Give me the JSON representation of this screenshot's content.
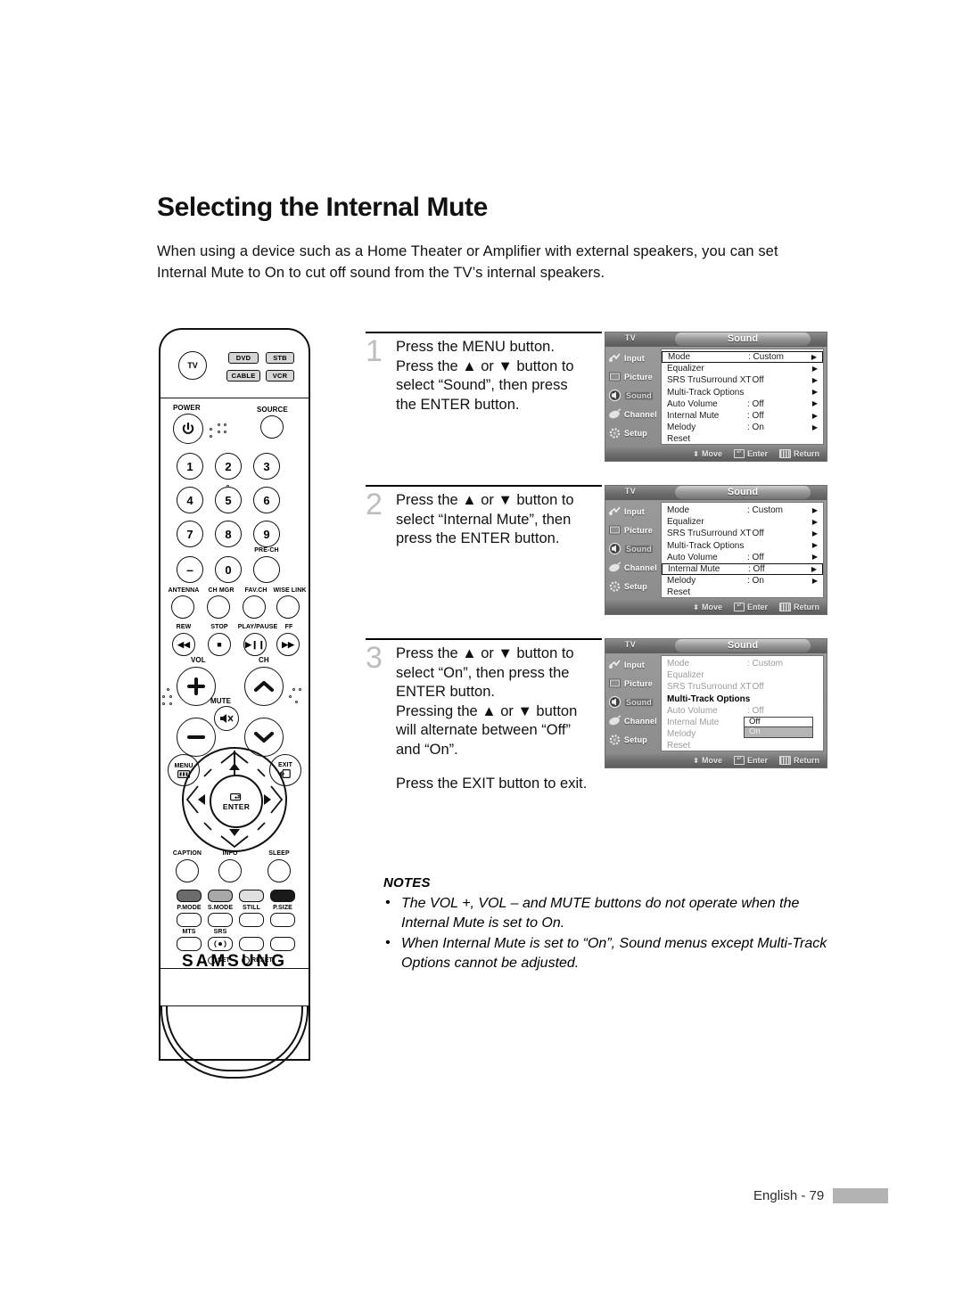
{
  "page": {
    "title": "Selecting the Internal Mute",
    "intro": "When using a device such as a Home Theater or Amplifier with external speakers, you can set Internal Mute to On to cut off sound from the TV’s internal speakers.",
    "footer_text": "English - 79"
  },
  "steps": [
    {
      "number": "1",
      "lines": [
        "Press the MENU button.",
        "Press the ▲ or ▼ button to",
        "select “Sound”, then press",
        "the ENTER button."
      ]
    },
    {
      "number": "2",
      "lines": [
        "Press the ▲ or ▼ button to",
        "select “Internal Mute”, then",
        "press the ENTER button."
      ]
    },
    {
      "number": "3",
      "lines": [
        "Press the ▲ or ▼ button to",
        "select “On”, then press the",
        "ENTER button.",
        "Pressing the ▲ or ▼ button",
        "will alternate between “Off”",
        "and “On”."
      ],
      "extra": "Press the EXIT button to exit."
    }
  ],
  "osd": {
    "tv_tab": "TV",
    "title": "Sound",
    "sidebar": [
      {
        "label": "Input",
        "icon": "input-icon"
      },
      {
        "label": "Picture",
        "icon": "picture-icon"
      },
      {
        "label": "Sound",
        "icon": "sound-icon"
      },
      {
        "label": "Channel",
        "icon": "channel-icon"
      },
      {
        "label": "Setup",
        "icon": "setup-icon"
      }
    ],
    "active_sidebar": "Sound",
    "bottom_bar": [
      {
        "label": "Move",
        "icon": "up-down-arrows-icon"
      },
      {
        "label": "Enter",
        "icon": "enter-key-icon"
      },
      {
        "label": "Return",
        "icon": "return-key-icon"
      }
    ],
    "panels": [
      {
        "name": "panel-step-1",
        "rows": [
          {
            "label": "Mode",
            "value": ": Custom",
            "arrow": "▶",
            "boxed": true
          },
          {
            "label": "Equalizer",
            "value": "",
            "arrow": "▶"
          },
          {
            "label": "SRS TruSurround XT",
            "value": ": Off",
            "arrow": "▶"
          },
          {
            "label": "Multi-Track Options",
            "value": "",
            "arrow": "▶"
          },
          {
            "label": "Auto Volume",
            "value": ": Off",
            "arrow": "▶"
          },
          {
            "label": "Internal Mute",
            "value": ": Off",
            "arrow": "▶"
          },
          {
            "label": "Melody",
            "value": ": On",
            "arrow": "▶"
          },
          {
            "label": "Reset",
            "value": "",
            "arrow": ""
          }
        ]
      },
      {
        "name": "panel-step-2",
        "rows": [
          {
            "label": "Mode",
            "value": ": Custom",
            "arrow": "▶"
          },
          {
            "label": "Equalizer",
            "value": "",
            "arrow": "▶"
          },
          {
            "label": "SRS TruSurround XT",
            "value": ": Off",
            "arrow": "▶"
          },
          {
            "label": "Multi-Track Options",
            "value": "",
            "arrow": "▶"
          },
          {
            "label": "Auto Volume",
            "value": ": Off",
            "arrow": "▶"
          },
          {
            "label": "Internal Mute",
            "value": ": Off",
            "arrow": "▶",
            "boxed": true
          },
          {
            "label": "Melody",
            "value": ": On",
            "arrow": "▶"
          },
          {
            "label": "Reset",
            "value": "",
            "arrow": ""
          }
        ]
      },
      {
        "name": "panel-step-3",
        "dropdown": {
          "options": [
            "Off",
            "On"
          ],
          "selected": "On"
        },
        "rows": [
          {
            "label": "Mode",
            "value": ": Custom",
            "arrow": "",
            "dim": true
          },
          {
            "label": "Equalizer",
            "value": "",
            "arrow": "",
            "dim": true
          },
          {
            "label": "SRS TruSurround XT",
            "value": ": Off",
            "arrow": "",
            "dim": true
          },
          {
            "label": "Multi-Track Options",
            "value": "",
            "arrow": "",
            "strong": true
          },
          {
            "label": "Auto Volume",
            "value": ": Off",
            "arrow": "",
            "dim": true
          },
          {
            "label": "Internal Mute",
            "value": "",
            "arrow": "",
            "dim": true
          },
          {
            "label": "Melody",
            "value": "",
            "arrow": "",
            "dim": true
          },
          {
            "label": "Reset",
            "value": "",
            "arrow": "",
            "dim": true
          }
        ]
      }
    ]
  },
  "notes": {
    "heading": "NOTES",
    "items": [
      "The VOL +, VOL – and MUTE buttons do not operate when the Internal Mute is set to On.",
      "When Internal Mute is set to “On”, Sound menus except Multi-Track Options cannot be adjusted."
    ]
  },
  "remote": {
    "brand": "SAMSUNG",
    "mode_buttons": [
      "DVD",
      "STB",
      "CABLE",
      "VCR"
    ],
    "tv_button": "TV",
    "power_label": "POWER",
    "source_label": "SOURCE",
    "keypad": [
      "1",
      "2",
      "3",
      "4",
      "5",
      "6",
      "7",
      "8",
      "9",
      "–",
      "0",
      ""
    ],
    "pre_ch_label": "PRE-CH",
    "function_row_labels": [
      "ANTENNA",
      "CH MGR",
      "FAV.CH",
      "WISE LINK"
    ],
    "transport_labels": [
      "REW",
      "STOP",
      "PLAY/PAUSE",
      "FF"
    ],
    "vol_label": "VOL",
    "ch_label": "CH",
    "mute_label": "MUTE",
    "menu_label": "MENU",
    "exit_label": "EXIT",
    "enter_label": "ENTER",
    "bottom_round_labels": [
      "CAPTION",
      "INFO",
      "SLEEP"
    ],
    "color_row_labels": [
      "P.MODE",
      "S.MODE",
      "STILL",
      "P.SIZE"
    ],
    "color_row_colors": [
      "#6b6b6b",
      "#a8a8a8",
      "#e0e0e0",
      "#1a1a1a"
    ],
    "mts_label": "MTS",
    "srs_label": "SRS",
    "set_label": "SET",
    "reset_label": "RESET"
  }
}
